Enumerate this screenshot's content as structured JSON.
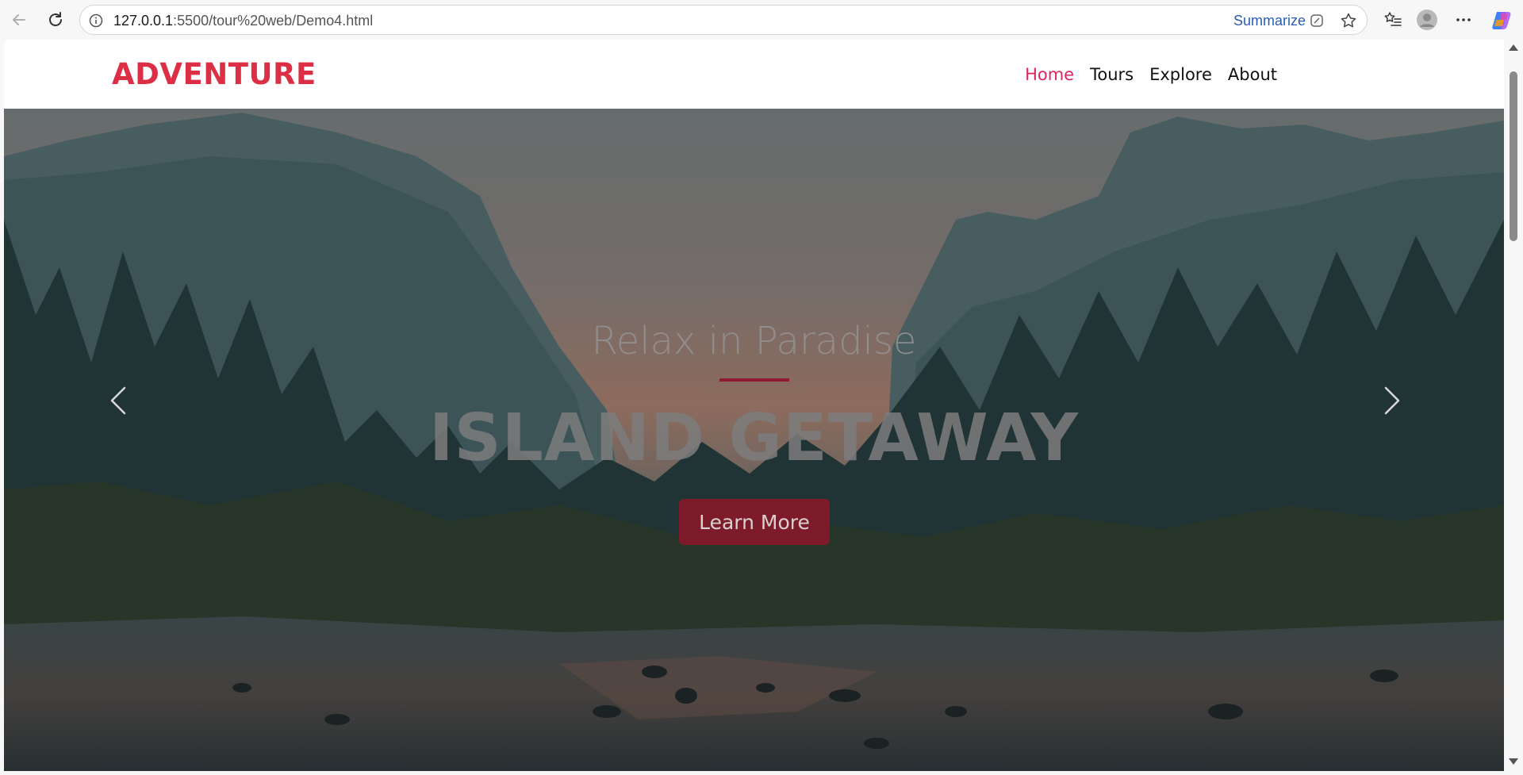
{
  "browser": {
    "url_host": "127.0.0.1",
    "url_rest": ":5500/tour%20web/Demo4.html",
    "summarize_label": "Summarize",
    "icons": {
      "back": "back-arrow-icon",
      "reload": "reload-icon",
      "info": "site-info-icon",
      "copilot_page": "copilot-page-icon",
      "favorite": "star-icon",
      "favorites_bar": "favorites-list-icon",
      "profile": "profile-avatar-icon",
      "more": "more-options-icon",
      "copilot": "copilot-icon"
    }
  },
  "site": {
    "logo": "ADVENTURE",
    "nav": [
      {
        "label": "Home",
        "active": true
      },
      {
        "label": "Tours",
        "active": false
      },
      {
        "label": "Explore",
        "active": false
      },
      {
        "label": "About",
        "active": false
      }
    ]
  },
  "hero": {
    "subtitle": "Relax in Paradise",
    "title": "ISLAND GETAWAY",
    "button_label": "Learn More",
    "prev_icon": "chevron-left-icon",
    "next_icon": "chevron-right-icon"
  },
  "colors": {
    "brand": "#dc2f45",
    "nav_active": "#e0245e",
    "button_bg": "#7e1b2b",
    "rule": "#8e1a36"
  }
}
